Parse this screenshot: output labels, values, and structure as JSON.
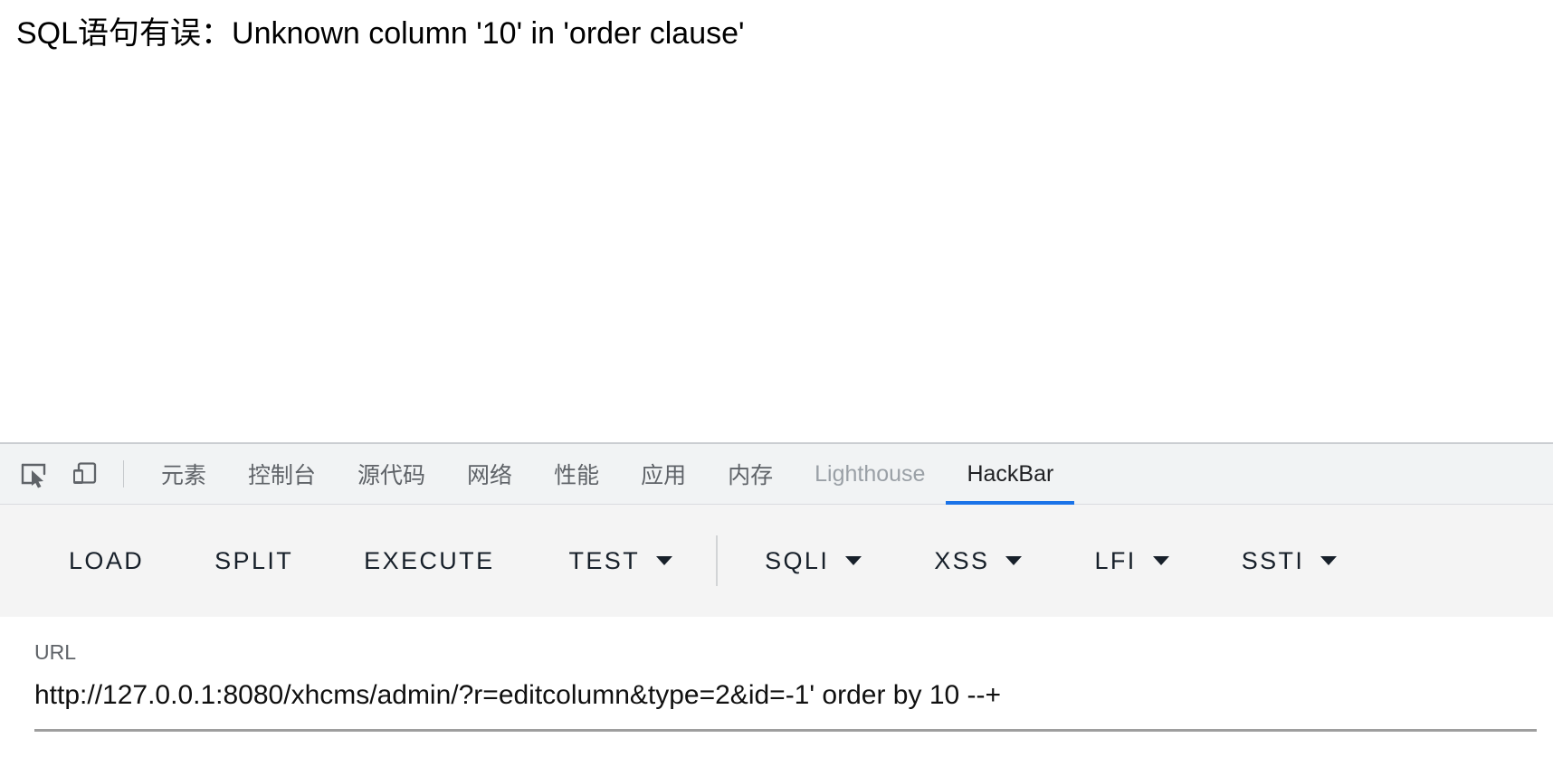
{
  "page": {
    "error_message": "SQL语句有误：Unknown column '10' in 'order clause'"
  },
  "devtools": {
    "icons": {
      "inspect": "inspect-element-icon",
      "device": "device-toolbar-icon"
    },
    "tabs": [
      {
        "label": "元素",
        "name": "tab-elements",
        "selected": false,
        "dim": false
      },
      {
        "label": "控制台",
        "name": "tab-console",
        "selected": false,
        "dim": false
      },
      {
        "label": "源代码",
        "name": "tab-sources",
        "selected": false,
        "dim": false
      },
      {
        "label": "网络",
        "name": "tab-network",
        "selected": false,
        "dim": false
      },
      {
        "label": "性能",
        "name": "tab-performance",
        "selected": false,
        "dim": false
      },
      {
        "label": "应用",
        "name": "tab-application",
        "selected": false,
        "dim": false
      },
      {
        "label": "内存",
        "name": "tab-memory",
        "selected": false,
        "dim": false
      },
      {
        "label": "Lighthouse",
        "name": "tab-lighthouse",
        "selected": false,
        "dim": true
      },
      {
        "label": "HackBar",
        "name": "tab-hackbar",
        "selected": true,
        "dim": false
      }
    ],
    "selected_tab": "HackBar",
    "accent_color": "#1a73e8",
    "tabbar_bg": "#f1f3f4"
  },
  "hackbar": {
    "toolbar": {
      "load_label": "LOAD",
      "split_label": "SPLIT",
      "execute_label": "EXECUTE",
      "test_label": "TEST",
      "sqli_label": "SQLI",
      "xss_label": "XSS",
      "lfi_label": "LFI",
      "ssti_label": "SSTI"
    },
    "url": {
      "label": "URL",
      "value": "http://127.0.0.1:8080/xhcms/admin/?r=editcolumn&type=2&id=-1' order by 10 --+",
      "placeholder": "URL"
    }
  }
}
